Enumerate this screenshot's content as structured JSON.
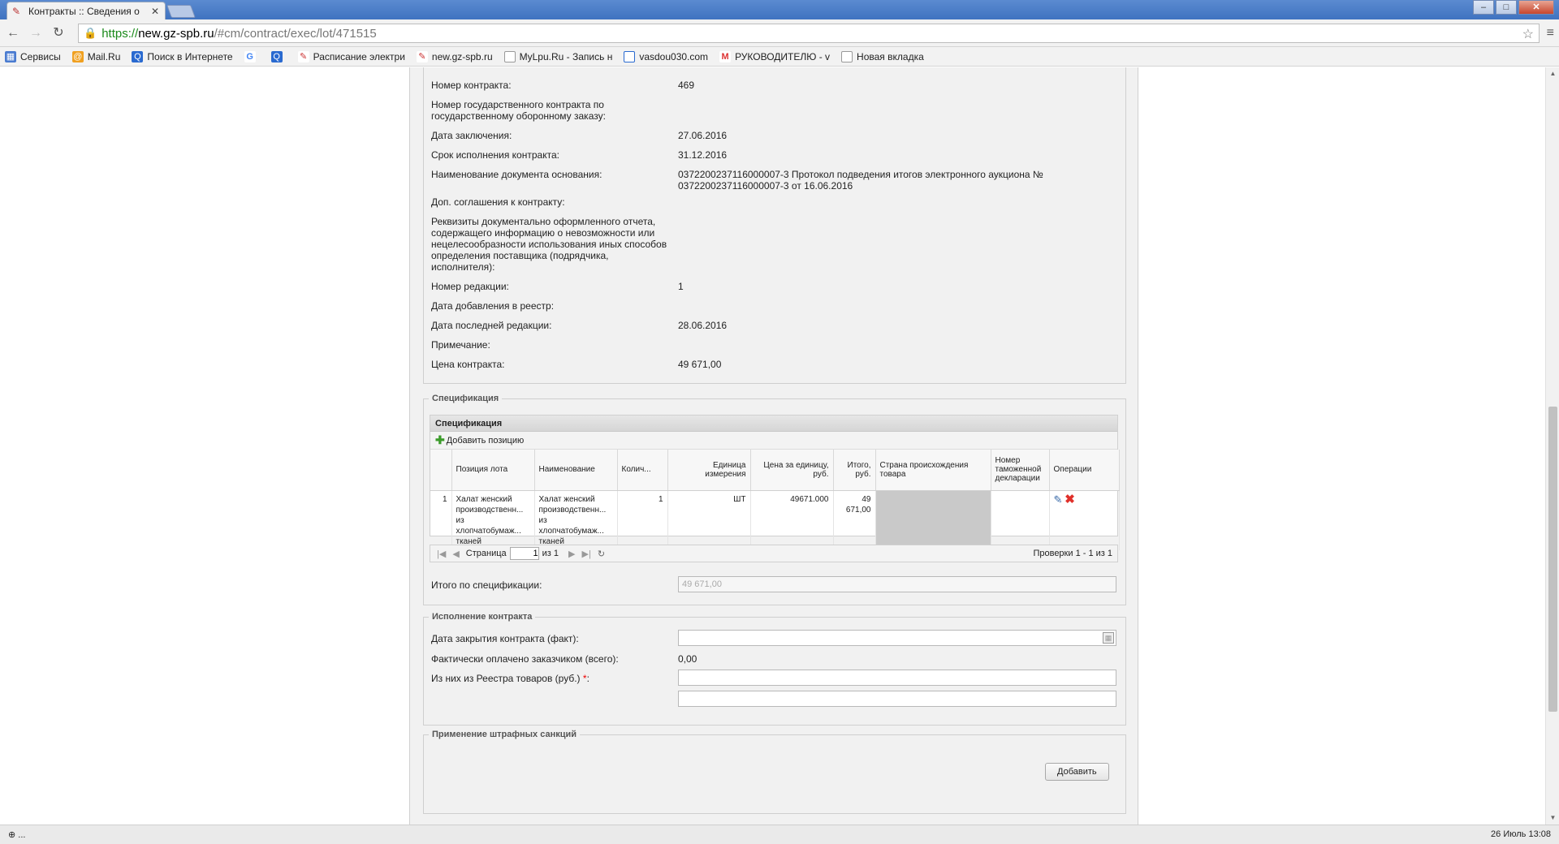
{
  "browser": {
    "tab_title": "Контракты :: Сведения о",
    "url_scheme": "https://",
    "url_host": "new.gz-spb.ru",
    "url_path": "/#cm/contract/exec/lot/471515",
    "bookmarks": [
      "Сервисы",
      "Mail.Ru",
      "Поиск в Интернете",
      "",
      "",
      "Расписание электри",
      "new.gz-spb.ru",
      "MyLpu.Ru - Запись н",
      "vasdou030.com",
      "РУКОВОДИТЕЛЮ - v",
      "Новая вкладка"
    ]
  },
  "contract": {
    "fields": [
      {
        "label": "Номер контракта:",
        "value": "469"
      },
      {
        "label": "Номер государственного контракта по государственному оборонному заказу:",
        "value": ""
      },
      {
        "label": "Дата заключения:",
        "value": "27.06.2016"
      },
      {
        "label": "Срок исполнения контракта:",
        "value": "31.12.2016"
      },
      {
        "label": "Наименование документа основания:",
        "value": "0372200237116000007-3 Протокол подведения итогов электронного аукциона № 0372200237116000007-3 от 16.06.2016"
      },
      {
        "label": "Доп. соглашения к контракту:",
        "value": ""
      },
      {
        "label": "Реквизиты документально оформленного отчета, содержащего информацию о невозможности или нецелесообразности использования иных способов определения поставщика (подрядчика, исполнителя):",
        "value": ""
      },
      {
        "label": "Номер редакции:",
        "value": "1"
      },
      {
        "label": "Дата добавления в реестр:",
        "value": ""
      },
      {
        "label": "Дата последней редакции:",
        "value": "28.06.2016"
      },
      {
        "label": "Примечание:",
        "value": ""
      },
      {
        "label": "Цена контракта:",
        "value": "49 671,00"
      }
    ]
  },
  "spec": {
    "legend": "Спецификация",
    "grid_title": "Спецификация",
    "add_label": "Добавить позицию",
    "columns": [
      "",
      "Позиция лота",
      "Наименование",
      "Колич...",
      "Единица измерения",
      "Цена за единицу, руб.",
      "Итого, руб.",
      "Страна происхождения товара",
      "Номер таможенной декларации",
      "Операции"
    ],
    "rows": [
      {
        "num": "1",
        "pos": "Халат женский производственн... из хлопчатобумаж... тканей",
        "name": "Халат женский производственн... из хлопчатобумаж... тканей",
        "qty": "1",
        "unit": "ШТ",
        "price": "49671.000",
        "total": "49 671,00",
        "country": "",
        "decl": ""
      }
    ],
    "pager": {
      "page_label": "Страница",
      "page": "1",
      "of": "из 1",
      "summary": "Проверки 1 - 1 из 1"
    },
    "total_label": "Итого по спецификации:",
    "total_value": "49 671,00"
  },
  "execution": {
    "legend": "Исполнение контракта",
    "close_date_label": "Дата закрытия контракта (факт):",
    "paid_label": "Фактически оплачено заказчиком (всего):",
    "paid_value": "0,00",
    "registry_label": "Из них из Реестра товаров (руб.)",
    "required_mark": "*",
    "colon": ":"
  },
  "penalties": {
    "legend": "Применение штрафных санкций",
    "add_button": "Добавить"
  },
  "status": {
    "left": "⊕ ...",
    "right": "26 Июль 13:08"
  },
  "colors": {
    "accent": "#3f73c0",
    "add_green": "#3b9b2a",
    "delete_red": "#e0302a"
  }
}
